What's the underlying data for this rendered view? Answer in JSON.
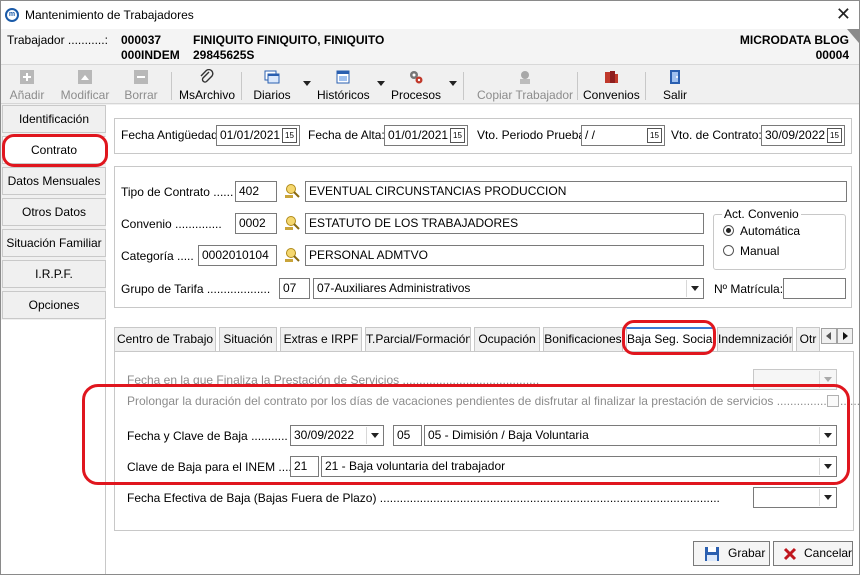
{
  "window": {
    "title": "Mantenimiento de Trabajadores",
    "close_glyph": "✕"
  },
  "header": {
    "worker_label": "Trabajador ...........:",
    "code1": "000037",
    "code2": "000INDEM",
    "name": "FINIQUITO FINIQUITO, FINIQUITO",
    "id_number": "29845625S",
    "company": "MICRODATA BLOG",
    "company_code": "00004"
  },
  "toolbar": {
    "add": "Añadir",
    "modify": "Modificar",
    "delete": "Borrar",
    "msarchivo": "MsArchivo",
    "diarios": "Diarios",
    "historicos": "Históricos",
    "procesos": "Procesos",
    "copy_worker": "Copiar Trabajador",
    "convenios": "Convenios",
    "exit": "Salir"
  },
  "sidebar": {
    "items": [
      "Identificación",
      "Contrato",
      "Datos Mensuales",
      "Otros Datos",
      "Situación Familiar",
      "I.R.P.F.",
      "Opciones"
    ]
  },
  "dates": {
    "antiguedad_label": "Fecha Antigüedad:",
    "antiguedad": "01/01/2021",
    "alta_label": "Fecha de Alta:",
    "alta": "01/01/2021",
    "prueba_label": "Vto. Periodo Prueba:",
    "prueba": " / /",
    "contrato_label": "Vto. de Contrato:",
    "contrato": "30/09/2022",
    "cal_glyph": "15"
  },
  "contract": {
    "tipo_label": "Tipo de Contrato ......",
    "tipo_code": "402",
    "tipo_desc": "EVENTUAL CIRCUNSTANCIAS PRODUCCION",
    "convenio_label": "Convenio ..............",
    "convenio_code": "0002",
    "convenio_desc": "ESTATUTO DE LOS TRABAJADORES",
    "categoria_label": "Categoría .....",
    "categoria_code": "0002010104",
    "categoria_desc": "PERSONAL ADMTVO",
    "tarifa_label": "Grupo de Tarifa ...................",
    "tarifa_code": "07",
    "tarifa_desc": "07-Auxiliares Administrativos",
    "act_convenio_title": "Act. Convenio",
    "automatica": "Automática",
    "manual": "Manual",
    "matricula_label": "Nº Matrícula:",
    "matricula": ""
  },
  "tabs": [
    "Centro de Trabajo",
    "Situación",
    "Extras e IRPF",
    "T.Parcial/Formación",
    "Ocupación",
    "Bonificaciones",
    "Baja Seg. Social",
    "Indemnización",
    "Otr"
  ],
  "baja": {
    "fin_prestacion_label": "Fecha en la que Finaliza la Prestación de Servicios .........................................",
    "prolongar_label": "Prolongar la duración del contrato por los días de vacaciones pendientes de disfrutar al finalizar la prestación de servicios .............................",
    "fecha_clave_label": "Fecha y Clave de Baja ...........",
    "fecha_baja": "30/09/2022",
    "clave_code": "05",
    "clave_desc": "05 - Dimisión / Baja Voluntaria",
    "inem_label": "Clave de Baja para el INEM ........",
    "inem_code": "21",
    "inem_desc": "21 - Baja voluntaria del trabajador",
    "efectiva_label": "Fecha Efectiva de Baja (Bajas Fuera de Plazo) ......................................................................................................"
  },
  "actions": {
    "save": "Grabar",
    "cancel": "Cancelar"
  },
  "colors": {
    "highlight": "#e0161e",
    "tab_accent": "#3a7bd5"
  }
}
